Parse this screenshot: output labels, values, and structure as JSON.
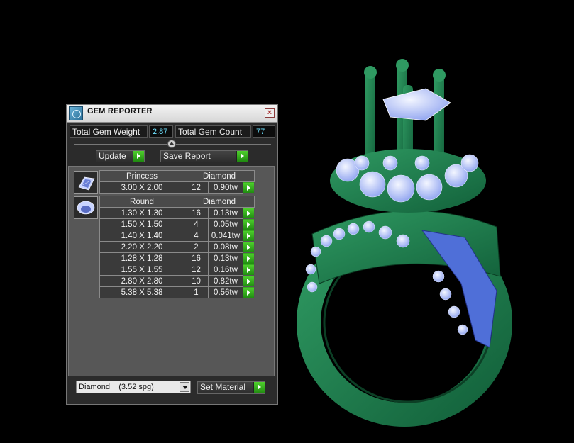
{
  "window": {
    "title": "GEM REPORTER",
    "total_weight_label": "Total Gem Weight",
    "total_weight_value": "2.87",
    "total_count_label": "Total Gem Count",
    "total_count_value": "77",
    "update_label": "Update",
    "save_report_label": "Save Report"
  },
  "groups": [
    {
      "shape": "Princess",
      "material": "Diamond",
      "rows": [
        {
          "size": "3.00 X 2.00",
          "count": "12",
          "weight": "0.90tw"
        }
      ]
    },
    {
      "shape": "Round",
      "material": "Diamond",
      "rows": [
        {
          "size": "1.30 X 1.30",
          "count": "16",
          "weight": "0.13tw"
        },
        {
          "size": "1.50 X 1.50",
          "count": "4",
          "weight": "0.05tw"
        },
        {
          "size": "1.40 X 1.40",
          "count": "4",
          "weight": "0.041tw"
        },
        {
          "size": "2.20 X 2.20",
          "count": "2",
          "weight": "0.08tw"
        },
        {
          "size": "1.28 X 1.28",
          "count": "16",
          "weight": "0.13tw"
        },
        {
          "size": "1.55 X 1.55",
          "count": "12",
          "weight": "0.16tw"
        },
        {
          "size": "2.80 X 2.80",
          "count": "10",
          "weight": "0.82tw"
        },
        {
          "size": "5.38 X 5.38",
          "count": "1",
          "weight": "0.56tw"
        }
      ]
    }
  ],
  "material_select": {
    "value": "Diamond    (3.52 spg)"
  },
  "set_material_label": "Set Material",
  "colors": {
    "ring_metal": "#1f7a4a",
    "gem": "#b9c8ff",
    "go_button": "#3cb41f",
    "value_text": "#6fe2ff"
  }
}
